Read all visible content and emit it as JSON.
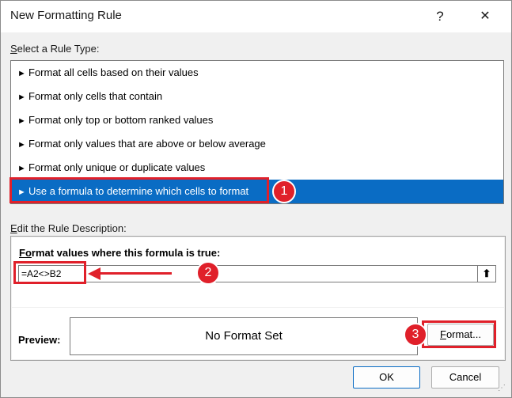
{
  "window": {
    "title": "New Formatting Rule",
    "help_label": "?",
    "close_label": "✕"
  },
  "rule_type": {
    "label": "Select a Rule Type:",
    "items": [
      {
        "label": "Format all cells based on their values"
      },
      {
        "label": "Format only cells that contain"
      },
      {
        "label": "Format only top or bottom ranked values"
      },
      {
        "label": "Format only values that are above or below average"
      },
      {
        "label": "Format only unique or duplicate values"
      },
      {
        "label": "Use a formula to determine which cells to format"
      }
    ],
    "selected_index": 5
  },
  "description": {
    "label": "Edit the Rule Description:",
    "formula_label": "Format values where this formula is true:",
    "formula_value": "=A2<>B2",
    "preview_label": "Preview:",
    "preview_text": "No Format Set",
    "format_button": "Format..."
  },
  "buttons": {
    "ok": "OK",
    "cancel": "Cancel"
  },
  "annotations": {
    "badges": [
      "1",
      "2",
      "3"
    ],
    "color": "#e0202a"
  },
  "colors": {
    "selection": "#0a6cc4",
    "dialog_bg": "#f0f0f0"
  }
}
